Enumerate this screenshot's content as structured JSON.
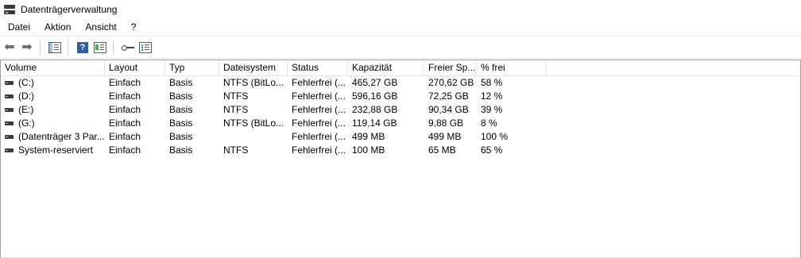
{
  "window": {
    "title": "Datenträgerverwaltung",
    "icon": "disk-management-icon"
  },
  "menu": [
    "Datei",
    "Aktion",
    "Ansicht",
    "?"
  ],
  "toolbar": {
    "buttons": [
      "back-arrow-icon",
      "forward-arrow-icon",
      "console-tree-icon",
      "help-icon",
      "properties-icon",
      "key-icon",
      "list-view-icon"
    ]
  },
  "table": {
    "columns": [
      "Volume",
      "Layout",
      "Typ",
      "Dateisystem",
      "Status",
      "Kapazität",
      "Freier Sp...",
      "% frei"
    ],
    "rows": [
      {
        "volume": "(C:)",
        "layout": "Einfach",
        "type": "Basis",
        "fs": "NTFS (BitLo...",
        "status": "Fehlerfrei (...",
        "capacity": "465,27 GB",
        "free": "270,62 GB",
        "pct": "58 %"
      },
      {
        "volume": "(D:)",
        "layout": "Einfach",
        "type": "Basis",
        "fs": "NTFS",
        "status": "Fehlerfrei (...",
        "capacity": "596,16 GB",
        "free": "72,25 GB",
        "pct": "12 %"
      },
      {
        "volume": "(E:)",
        "layout": "Einfach",
        "type": "Basis",
        "fs": "NTFS",
        "status": "Fehlerfrei (...",
        "capacity": "232,88 GB",
        "free": "90,34 GB",
        "pct": "39 %"
      },
      {
        "volume": "(G:)",
        "layout": "Einfach",
        "type": "Basis",
        "fs": "NTFS (BitLo...",
        "status": "Fehlerfrei (...",
        "capacity": "119,14 GB",
        "free": "9,88 GB",
        "pct": "8 %"
      },
      {
        "volume": "(Datenträger 3 Par...",
        "layout": "Einfach",
        "type": "Basis",
        "fs": "",
        "status": "Fehlerfrei (...",
        "capacity": "499 MB",
        "free": "499 MB",
        "pct": "100 %"
      },
      {
        "volume": "System-reserviert",
        "layout": "Einfach",
        "type": "Basis",
        "fs": "NTFS",
        "status": "Fehlerfrei (...",
        "capacity": "100 MB",
        "free": "65 MB",
        "pct": "65 %"
      }
    ]
  }
}
